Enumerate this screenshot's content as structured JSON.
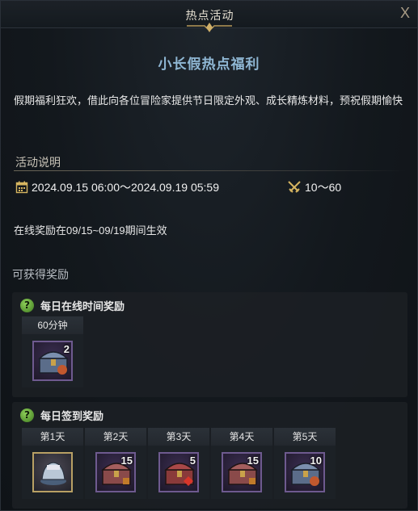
{
  "window": {
    "title": "热点活动",
    "close_label": "X"
  },
  "event": {
    "title": "小长假热点福利",
    "description": "假期福利狂欢，借此向各位冒险家提供节日限定外观、成长精炼材料，预祝假期愉快",
    "section_title": "活动说明",
    "date_range": "2024.09.15 06:00～2024.09.19 05:59",
    "level_range": "10～60",
    "online_note": "在线奖励在09/15~09/19期间生效"
  },
  "rewards": {
    "heading": "可获得奖励",
    "online": {
      "label": "每日在线时间奖励",
      "slots": [
        {
          "header": "60分钟",
          "count": "2",
          "icon": "chest-icon"
        }
      ]
    },
    "checkin": {
      "label": "每日签到奖励",
      "slots": [
        {
          "header": "第1天",
          "count": "",
          "icon": "helmet-costume-icon"
        },
        {
          "header": "第2天",
          "count": "15",
          "icon": "chest-icon"
        },
        {
          "header": "第3天",
          "count": "5",
          "icon": "chest-icon"
        },
        {
          "header": "第4天",
          "count": "15",
          "icon": "chest-icon"
        },
        {
          "header": "第5天",
          "count": "10",
          "icon": "chest-icon"
        }
      ]
    }
  },
  "colors": {
    "title_blue": "#8fb7d4",
    "accent_gold": "#b8a064",
    "help_green": "#6fb33c"
  }
}
